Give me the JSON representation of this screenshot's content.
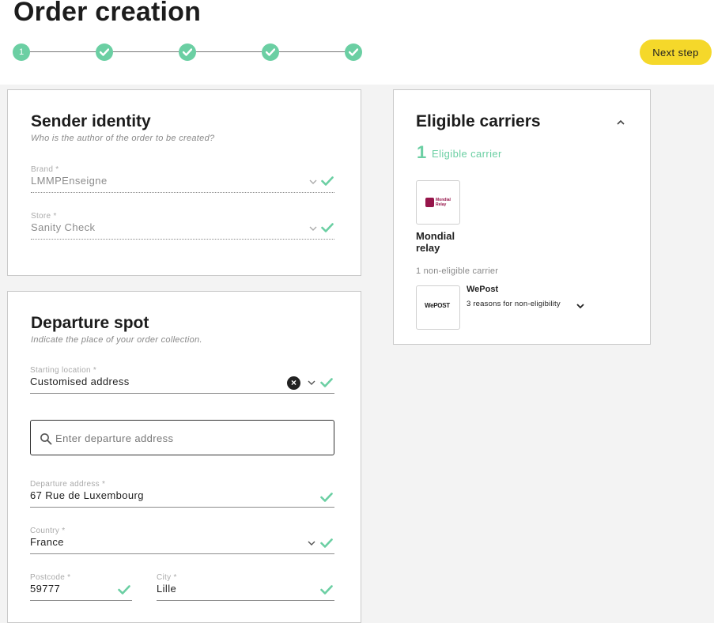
{
  "page": {
    "title": "Order creation"
  },
  "stepper": {
    "current_label": "1"
  },
  "actions": {
    "next_step": "Next step"
  },
  "sender": {
    "title": "Sender identity",
    "subtitle": "Who is the author of the order to be created?",
    "brand": {
      "label": "Brand *",
      "value": "LMMPEnseigne"
    },
    "store": {
      "label": "Store *",
      "value": "Sanity Check"
    }
  },
  "departure": {
    "title": "Departure spot",
    "subtitle": "Indicate the place of your order collection.",
    "starting_location": {
      "label": "Starting location *",
      "value": "Customised address"
    },
    "search": {
      "placeholder": "Enter departure address"
    },
    "address": {
      "label": "Departure address *",
      "value": "67 Rue de Luxembourg"
    },
    "country": {
      "label": "Country *",
      "value": "France"
    },
    "postcode": {
      "label": "Postcode *",
      "value": "59777"
    },
    "city": {
      "label": "City *",
      "value": "Lille"
    }
  },
  "carriers": {
    "title": "Eligible carriers",
    "eligible_count": "1",
    "eligible_label": "Eligible carrier",
    "eligible": [
      {
        "name": "Mondial relay",
        "logo_text": "Mondial Relay"
      }
    ],
    "non_eligible_label": "1 non-eligible carrier",
    "non_eligible": [
      {
        "name": "WePost",
        "reasons": "3 reasons for non-eligibility",
        "logo_text": "WePOST"
      }
    ]
  },
  "colors": {
    "accent_green": "#6bcfa3",
    "button_yellow": "#f5d82a",
    "mondial_red": "#96154a"
  }
}
